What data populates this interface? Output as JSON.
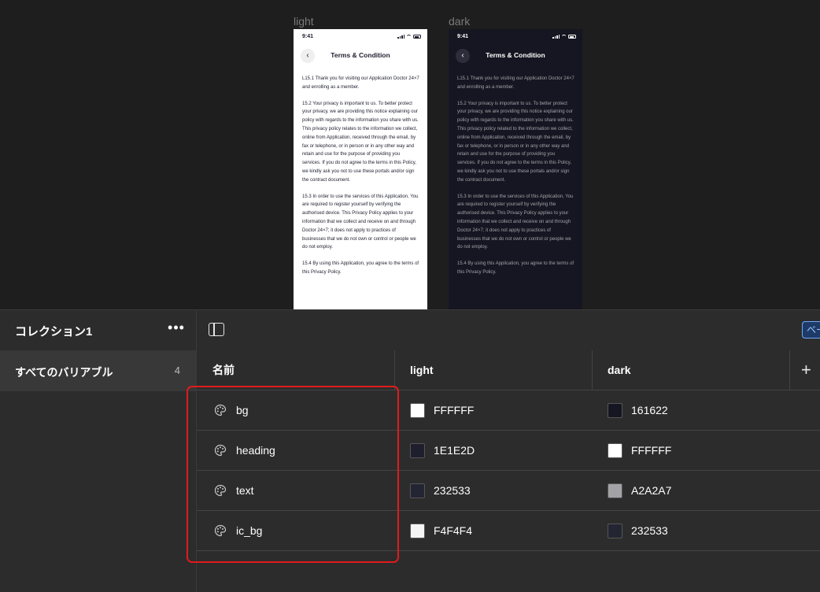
{
  "canvas": {
    "frames": [
      {
        "label": "light",
        "status_time": "9:41",
        "nav_title": "Terms & Condition",
        "paragraphs": [
          "L15.1 Thank you for visiting our Application Doctor 24×7 and enrolling as a member.",
          "15.2 Your privacy is important to us. To better protect your privacy, we are providing this notice explaining our policy with regards to the information you share with us. This privacy policy relates to the information we collect, online from Application, received through the email, by fax or telephone, or in person or in any other way and retain and use for the purpose of providing you services. If you do not agree to the terms in this Policy, we kindly ask you not to use these portals and/or sign the contract document.",
          "15.3 In order to use the services of this Application, You are required to register yourself by verifying the authorised device. This Privacy Policy applies to your information that we collect and receive on and through Doctor 24×7; it does not apply to practices of businesses that we do not own or control or people we do not employ.",
          "15.4 By using this Application, you agree to the terms of this Privacy Policy."
        ]
      },
      {
        "label": "dark",
        "status_time": "9:41",
        "nav_title": "Terms & Condition",
        "paragraphs": [
          "L15.1 Thank you for visiting our Application Doctor 24×7 and enrolling as a member.",
          "15.2 Your privacy is important to us. To better protect your privacy, we are providing this notice explaining our policy with regards to the information you share with us. This privacy policy related to the information we collect, online from Application, received through the email, by fax or telephone, or in person or in any other way and retain and use for the purpose of providing you services. If you do not agree to the terms in this Policy, we kindly ask you not to use these portals and/or sign the contract document.",
          "15.3 In order to use the services of this Application, You are required to register yourself by verifying the authorised device. This Privacy Policy applies to your information that we collect and receive on and through Doctor 24×7; it does not apply to practices of businesses that we do not own or control or people we do not employ.",
          "15.4 By using this Application, you agree to the terms of this Privacy Policy."
        ]
      }
    ]
  },
  "sidebar": {
    "collection_title": "コレクション1",
    "more_label": "•••",
    "all_variables_label": "すべてのバリアブル",
    "all_variables_count": "4"
  },
  "toolbar": {
    "mode_chip_label": "ベース"
  },
  "table": {
    "headers": {
      "name": "名前",
      "light": "light",
      "dark": "dark",
      "add": "+"
    },
    "rows": [
      {
        "name": "bg",
        "light": {
          "hex": "FFFFFF",
          "color": "#FFFFFF"
        },
        "dark": {
          "hex": "161622",
          "color": "#161622"
        }
      },
      {
        "name": "heading",
        "light": {
          "hex": "1E1E2D",
          "color": "#1E1E2D"
        },
        "dark": {
          "hex": "FFFFFF",
          "color": "#FFFFFF"
        }
      },
      {
        "name": "text",
        "light": {
          "hex": "232533",
          "color": "#232533"
        },
        "dark": {
          "hex": "A2A2A7",
          "color": "#A2A2A7"
        }
      },
      {
        "name": "ic_bg",
        "light": {
          "hex": "F4F4F4",
          "color": "#F4F4F4"
        },
        "dark": {
          "hex": "232533",
          "color": "#232533"
        }
      }
    ]
  },
  "colors": {
    "highlight": "#E01B1B",
    "accent": "#6DA8FF"
  }
}
